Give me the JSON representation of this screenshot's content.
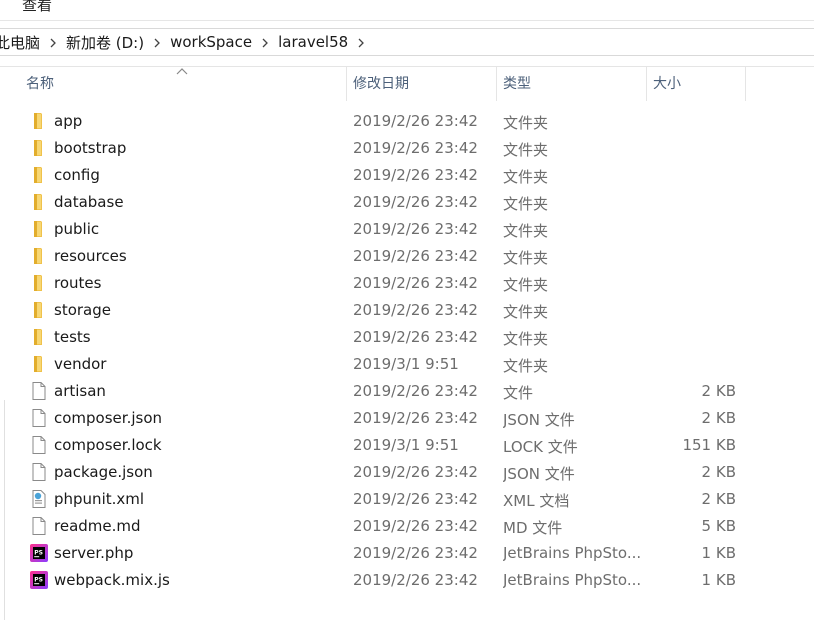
{
  "ribbon": {
    "view_tab": "查看"
  },
  "address": {
    "crumbs": [
      "此电脑",
      "新加卷 (D:)",
      "workSpace",
      "laravel58"
    ]
  },
  "columns": {
    "name": "名称",
    "date": "修改日期",
    "type": "类型",
    "size": "大小",
    "sort_column": "name",
    "sort_direction": "ascending"
  },
  "files": [
    {
      "name": "app",
      "date": "2019/2/26 23:42",
      "type": "文件夹",
      "size": "",
      "icon": "folder-icon"
    },
    {
      "name": "bootstrap",
      "date": "2019/2/26 23:42",
      "type": "文件夹",
      "size": "",
      "icon": "folder-icon"
    },
    {
      "name": "config",
      "date": "2019/2/26 23:42",
      "type": "文件夹",
      "size": "",
      "icon": "folder-icon"
    },
    {
      "name": "database",
      "date": "2019/2/26 23:42",
      "type": "文件夹",
      "size": "",
      "icon": "folder-icon"
    },
    {
      "name": "public",
      "date": "2019/2/26 23:42",
      "type": "文件夹",
      "size": "",
      "icon": "folder-icon"
    },
    {
      "name": "resources",
      "date": "2019/2/26 23:42",
      "type": "文件夹",
      "size": "",
      "icon": "folder-icon"
    },
    {
      "name": "routes",
      "date": "2019/2/26 23:42",
      "type": "文件夹",
      "size": "",
      "icon": "folder-icon"
    },
    {
      "name": "storage",
      "date": "2019/2/26 23:42",
      "type": "文件夹",
      "size": "",
      "icon": "folder-icon"
    },
    {
      "name": "tests",
      "date": "2019/2/26 23:42",
      "type": "文件夹",
      "size": "",
      "icon": "folder-icon"
    },
    {
      "name": "vendor",
      "date": "2019/3/1 9:51",
      "type": "文件夹",
      "size": "",
      "icon": "folder-icon"
    },
    {
      "name": "artisan",
      "date": "2019/2/26 23:42",
      "type": "文件",
      "size": "2 KB",
      "icon": "file-icon"
    },
    {
      "name": "composer.json",
      "date": "2019/2/26 23:42",
      "type": "JSON 文件",
      "size": "2 KB",
      "icon": "file-icon"
    },
    {
      "name": "composer.lock",
      "date": "2019/3/1 9:51",
      "type": "LOCK 文件",
      "size": "151 KB",
      "icon": "file-icon"
    },
    {
      "name": "package.json",
      "date": "2019/2/26 23:42",
      "type": "JSON 文件",
      "size": "2 KB",
      "icon": "file-icon"
    },
    {
      "name": "phpunit.xml",
      "date": "2019/2/26 23:42",
      "type": "XML 文档",
      "size": "2 KB",
      "icon": "xml-file-icon"
    },
    {
      "name": "readme.md",
      "date": "2019/2/26 23:42",
      "type": "MD 文件",
      "size": "5 KB",
      "icon": "file-icon"
    },
    {
      "name": "server.php",
      "date": "2019/2/26 23:42",
      "type": "JetBrains PhpSto...",
      "size": "1 KB",
      "icon": "phpstorm-icon"
    },
    {
      "name": "webpack.mix.js",
      "date": "2019/2/26 23:42",
      "type": "JetBrains PhpSto...",
      "size": "1 KB",
      "icon": "phpstorm-icon"
    }
  ],
  "colors": {
    "folder": "#f0c24b",
    "header_text": "#4c607a",
    "secondary_text": "#6d6d6d",
    "phpstorm_gradient": [
      "#ff318c",
      "#8b3dff"
    ]
  }
}
